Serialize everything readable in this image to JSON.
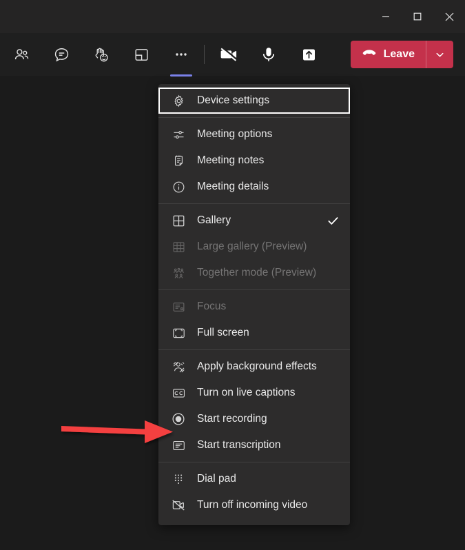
{
  "window": {
    "controls": [
      {
        "name": "minimize",
        "glyph": "minimize-icon"
      },
      {
        "name": "maximize",
        "glyph": "maximize-icon"
      },
      {
        "name": "close",
        "glyph": "close-icon"
      }
    ]
  },
  "toolbar": {
    "icons": [
      {
        "name": "people-icon",
        "label": "Show participants",
        "active": false
      },
      {
        "name": "chat-icon",
        "label": "Show conversation",
        "active": false
      },
      {
        "name": "raise-hand-reactions-icon",
        "label": "Reactions",
        "active": false
      },
      {
        "name": "share-screen-icon",
        "label": "Share content",
        "active": false
      },
      {
        "name": "more-options-icon",
        "label": "More actions",
        "active": true
      }
    ],
    "media": [
      {
        "name": "camera-off-icon",
        "label": "Turn camera on"
      },
      {
        "name": "microphone-icon",
        "label": "Mute"
      },
      {
        "name": "share-tray-icon",
        "label": "Share"
      }
    ],
    "leave": {
      "label": "Leave",
      "icon": "hangup-icon",
      "caret_icon": "chevron-down-icon",
      "color": "#c4314b"
    },
    "active_accent_color": "#7b83eb"
  },
  "menu": {
    "sections": [
      {
        "items": [
          {
            "label": "Device settings",
            "icon": "gear-icon",
            "disabled": false,
            "checked": false,
            "focused": true
          }
        ]
      },
      {
        "items": [
          {
            "label": "Meeting options",
            "icon": "sliders-icon",
            "disabled": false,
            "checked": false,
            "focused": false
          },
          {
            "label": "Meeting notes",
            "icon": "notes-icon",
            "disabled": false,
            "checked": false,
            "focused": false
          },
          {
            "label": "Meeting details",
            "icon": "info-icon",
            "disabled": false,
            "checked": false,
            "focused": false
          }
        ]
      },
      {
        "items": [
          {
            "label": "Gallery",
            "icon": "gallery-icon",
            "disabled": false,
            "checked": true,
            "focused": false
          },
          {
            "label": "Large gallery (Preview)",
            "icon": "large-gallery-icon",
            "disabled": true,
            "checked": false,
            "focused": false
          },
          {
            "label": "Together mode (Preview)",
            "icon": "together-mode-icon",
            "disabled": true,
            "checked": false,
            "focused": false
          }
        ]
      },
      {
        "items": [
          {
            "label": "Focus",
            "icon": "focus-icon",
            "disabled": true,
            "checked": false,
            "focused": false
          },
          {
            "label": "Full screen",
            "icon": "full-screen-icon",
            "disabled": false,
            "checked": false,
            "focused": false
          }
        ]
      },
      {
        "items": [
          {
            "label": "Apply background effects",
            "icon": "background-effects-icon",
            "disabled": false,
            "checked": false,
            "focused": false
          },
          {
            "label": "Turn on live captions",
            "icon": "closed-captions-icon",
            "disabled": false,
            "checked": false,
            "focused": false
          },
          {
            "label": "Start recording",
            "icon": "record-icon",
            "disabled": false,
            "checked": false,
            "focused": false
          },
          {
            "label": "Start transcription",
            "icon": "transcription-icon",
            "disabled": false,
            "checked": false,
            "focused": false
          }
        ]
      },
      {
        "items": [
          {
            "label": "Dial pad",
            "icon": "dial-pad-icon",
            "disabled": false,
            "checked": false,
            "focused": false
          },
          {
            "label": "Turn off incoming video",
            "icon": "incoming-video-off-icon",
            "disabled": false,
            "checked": false,
            "focused": false
          }
        ]
      }
    ]
  },
  "annotation": {
    "arrow": {
      "color": "#f43f3f",
      "points_to": "Start recording"
    }
  }
}
